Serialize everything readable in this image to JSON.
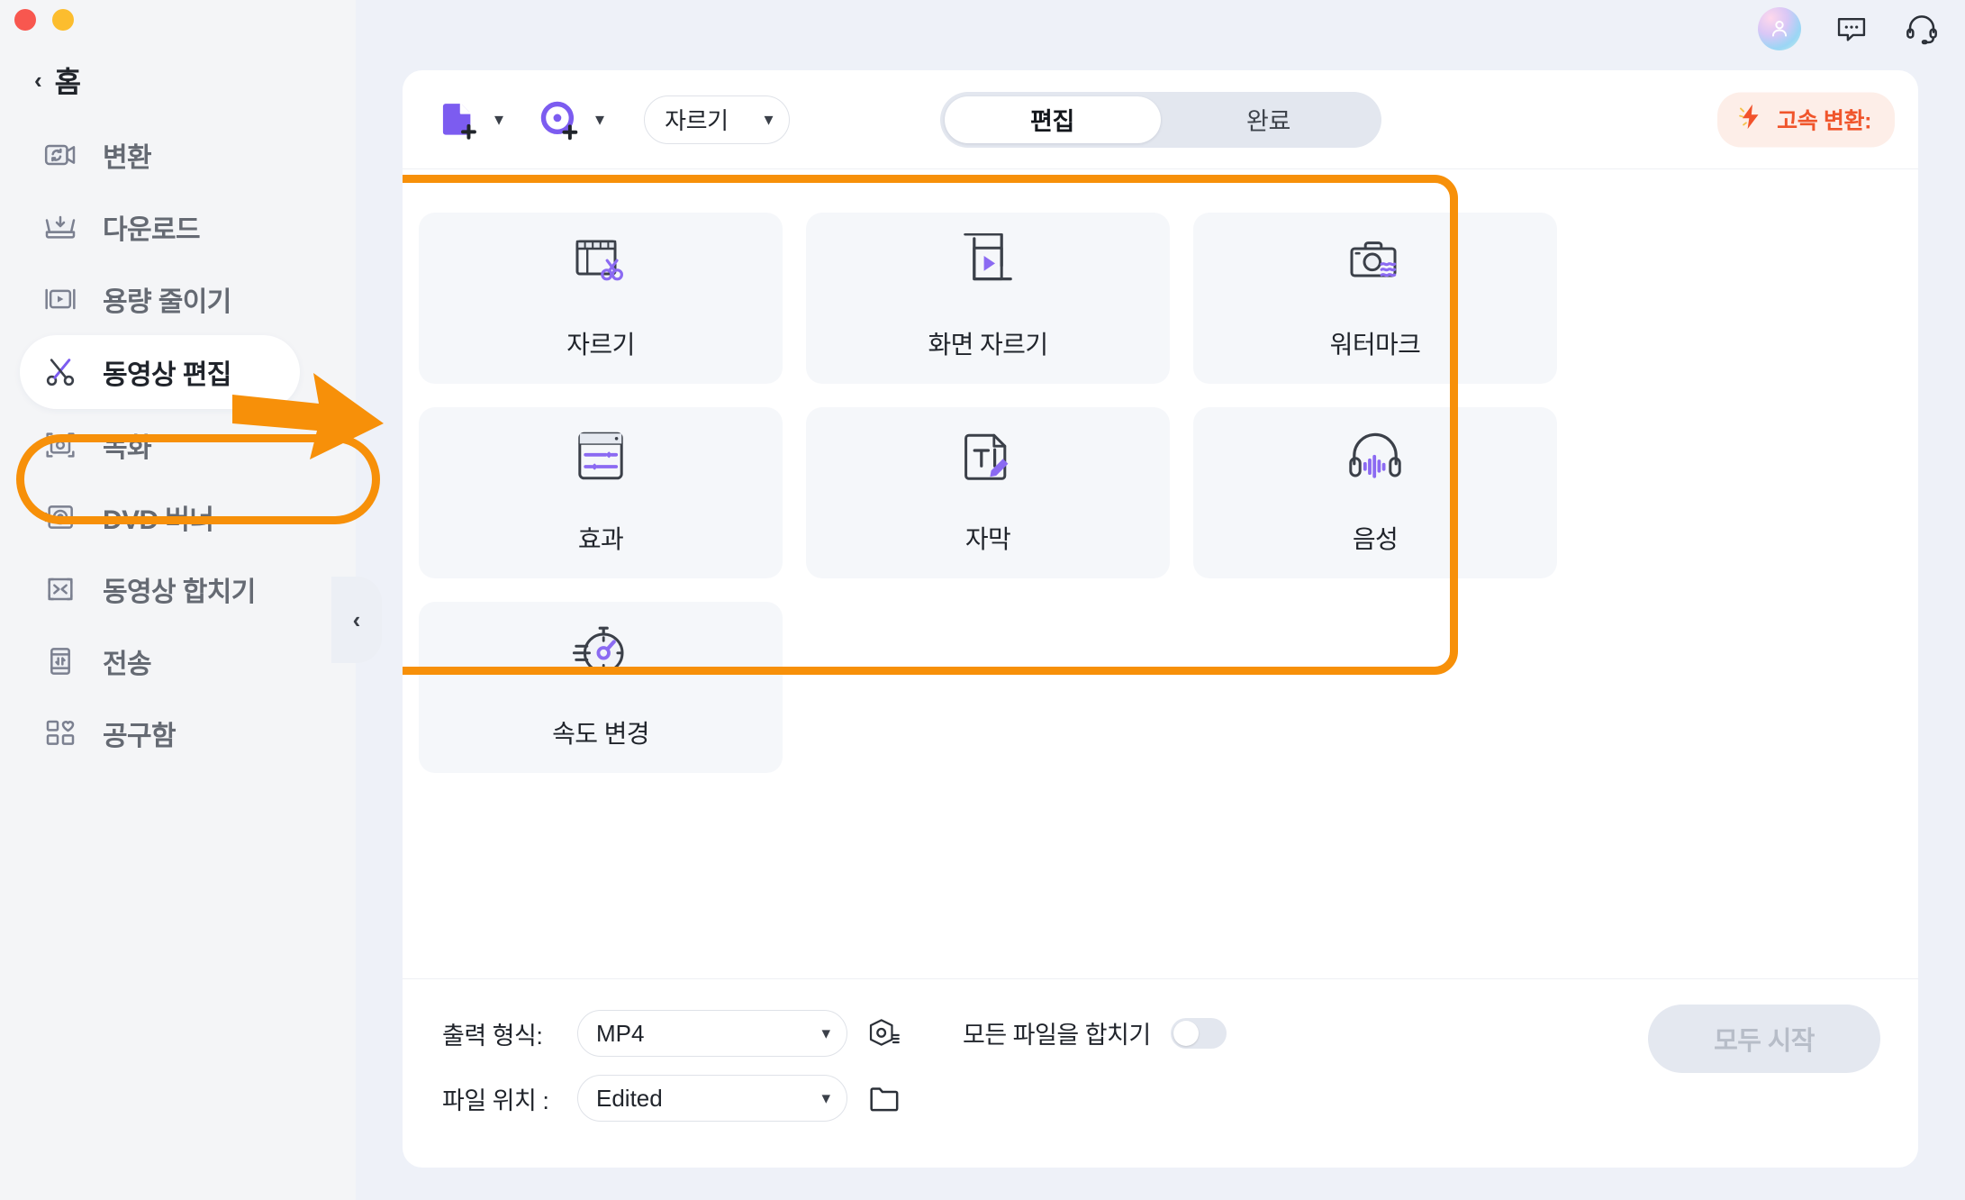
{
  "window": {
    "controls": [
      "close",
      "minimize"
    ]
  },
  "top_actions": {
    "avatar_name": "user-avatar",
    "message_icon": "message-bubble-icon",
    "support_icon": "headset-support-icon"
  },
  "sidebar": {
    "home_label": "홈",
    "back_icon": "chevron-left-icon",
    "collapse_icon": "chevron-left-icon",
    "items": [
      {
        "label": "변환",
        "icon": "convert-icon",
        "active": false
      },
      {
        "label": "다운로드",
        "icon": "download-icon",
        "active": false
      },
      {
        "label": "용량 줄이기",
        "icon": "compress-icon",
        "active": false
      },
      {
        "label": "동영상 편집",
        "icon": "scissors-icon",
        "active": true
      },
      {
        "label": "녹화",
        "icon": "record-icon",
        "active": false
      },
      {
        "label": "DVD 버너",
        "icon": "dvd-burner-icon",
        "active": false
      },
      {
        "label": "동영상 합치기",
        "icon": "merge-video-icon",
        "active": false
      },
      {
        "label": "전송",
        "icon": "transfer-icon",
        "active": false
      },
      {
        "label": "공구함",
        "icon": "toolbox-icon",
        "active": false
      }
    ]
  },
  "toolbar": {
    "add_file_icon": "add-file-icon",
    "add_file_chevron": "chevron-down-icon",
    "add_disc_icon": "add-disc-icon",
    "add_disc_chevron": "chevron-down-icon",
    "mode_select": {
      "value": "자르기",
      "chevron": "chevron-down-icon"
    },
    "tabs": [
      {
        "label": "편집",
        "active": true
      },
      {
        "label": "완료",
        "active": false
      }
    ],
    "fast_badge": {
      "label": "고속 변환:",
      "icon": "lightning-bolt-icon",
      "color": "#f0552b"
    }
  },
  "features": [
    {
      "label": "자르기",
      "icon": "trim-filmstrip-scissors-icon"
    },
    {
      "label": "화면 자르기",
      "icon": "crop-frame-play-icon"
    },
    {
      "label": "워터마크",
      "icon": "camera-watermark-icon"
    },
    {
      "label": "효과",
      "icon": "effects-sliders-icon"
    },
    {
      "label": "자막",
      "icon": "subtitle-text-pencil-icon"
    },
    {
      "label": "음성",
      "icon": "headphones-waveform-icon"
    },
    {
      "label": "속도 변경",
      "icon": "stopwatch-speed-icon"
    }
  ],
  "annotation": {
    "highlight_color": "#f79009",
    "arrow_icon": "arrow-right-annotation"
  },
  "bottom": {
    "format_label": "출력 형식:",
    "format_value": "MP4",
    "format_chevron": "chevron-down-icon",
    "format_settings_icon": "format-settings-icon",
    "location_label": "파일 위치 :",
    "location_value": "Edited",
    "location_chevron": "chevron-down-icon",
    "folder_icon": "folder-icon",
    "merge_label": "모든 파일을 합치기",
    "merge_enabled": false,
    "start_button": "모두 시작"
  },
  "theme": {
    "accent_purple": "#7c5cf0",
    "highlight_orange": "#f79009",
    "panel_bg": "#eef1f8",
    "card_bg": "#f5f7fa"
  }
}
